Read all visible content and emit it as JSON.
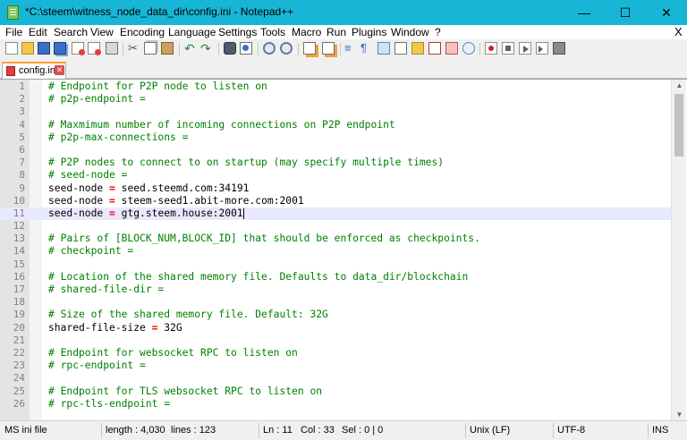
{
  "window": {
    "title": "*C:\\steem\\witness_node_data_dir\\config.ini - Notepad++",
    "minimize": "—",
    "maximize": "☐",
    "close": "✕"
  },
  "menu": {
    "items": [
      "File",
      "Edit",
      "Search",
      "View",
      "Encoding",
      "Language",
      "Settings",
      "Tools",
      "Macro",
      "Run",
      "Plugins",
      "Window",
      "?"
    ],
    "close_doc": "X"
  },
  "toolbar": {
    "icons": [
      "new-file-icon",
      "open-file-icon",
      "save-icon",
      "save-all-icon",
      "close-icon",
      "close-all-icon",
      "print-icon",
      "cut-icon",
      "copy-icon",
      "paste-icon",
      "undo-icon",
      "redo-icon",
      "find-icon",
      "replace-icon",
      "zoom-in-icon",
      "zoom-out-icon",
      "sync-vertical-icon",
      "sync-horizontal-icon",
      "word-wrap-icon",
      "show-all-chars-icon",
      "indent-guide-icon",
      "doc-map-icon",
      "function-list-icon",
      "folder-workspace-icon",
      "doc-switcher-icon",
      "monitoring-icon",
      "record-macro-icon",
      "stop-macro-icon",
      "play-macro-icon",
      "run-macro-multiple-icon",
      "save-macro-icon"
    ]
  },
  "tab": {
    "label": "config.ini",
    "close": "✕"
  },
  "editor": {
    "current_line": 11,
    "lines": [
      {
        "n": "1",
        "type": "comment",
        "text": "# Endpoint for P2P node to listen on"
      },
      {
        "n": "2",
        "type": "comment",
        "text": "# p2p-endpoint ="
      },
      {
        "n": "3",
        "type": "blank",
        "text": ""
      },
      {
        "n": "4",
        "type": "comment",
        "text": "# Maxmimum number of incoming connections on P2P endpoint"
      },
      {
        "n": "5",
        "type": "comment",
        "text": "# p2p-max-connections ="
      },
      {
        "n": "6",
        "type": "blank",
        "text": ""
      },
      {
        "n": "7",
        "type": "comment",
        "text": "# P2P nodes to connect to on startup (may specify multiple times)"
      },
      {
        "n": "8",
        "type": "comment",
        "text": "# seed-node ="
      },
      {
        "n": "9",
        "type": "kv",
        "key": "seed-node",
        "eq": "=",
        "value": "seed.steemd.com:34191"
      },
      {
        "n": "10",
        "type": "kv",
        "key": "seed-node",
        "eq": "=",
        "value": "steem-seed1.abit-more.com:2001"
      },
      {
        "n": "11",
        "type": "kv",
        "key": "seed-node",
        "eq": "=",
        "value": "gtg.steem.house:2001"
      },
      {
        "n": "12",
        "type": "blank",
        "text": ""
      },
      {
        "n": "13",
        "type": "comment",
        "text": "# Pairs of [BLOCK_NUM,BLOCK_ID] that should be enforced as checkpoints."
      },
      {
        "n": "14",
        "type": "comment",
        "text": "# checkpoint ="
      },
      {
        "n": "15",
        "type": "blank",
        "text": ""
      },
      {
        "n": "16",
        "type": "comment",
        "text": "# Location of the shared memory file. Defaults to data_dir/blockchain"
      },
      {
        "n": "17",
        "type": "comment",
        "text": "# shared-file-dir ="
      },
      {
        "n": "18",
        "type": "blank",
        "text": ""
      },
      {
        "n": "19",
        "type": "comment",
        "text": "# Size of the shared memory file. Default: 32G"
      },
      {
        "n": "20",
        "type": "kv",
        "key": "shared-file-size",
        "eq": "=",
        "value": "32G"
      },
      {
        "n": "21",
        "type": "blank",
        "text": ""
      },
      {
        "n": "22",
        "type": "comment",
        "text": "# Endpoint for websocket RPC to listen on"
      },
      {
        "n": "23",
        "type": "comment",
        "text": "# rpc-endpoint ="
      },
      {
        "n": "24",
        "type": "blank",
        "text": ""
      },
      {
        "n": "25",
        "type": "comment",
        "text": "# Endpoint for TLS websocket RPC to listen on"
      },
      {
        "n": "26",
        "type": "comment",
        "text": "# rpc-tls-endpoint ="
      }
    ]
  },
  "scrollbar": {
    "up": "▲",
    "down": "▼"
  },
  "status": {
    "language": "MS ini file",
    "length": "length : 4,030",
    "lines": "lines : 123",
    "ln": "Ln : 11",
    "col": "Col : 33",
    "sel": "Sel : 0 | 0",
    "eol": "Unix (LF)",
    "encoding": "UTF-8",
    "mode": "INS"
  },
  "colors": {
    "titlebar": "#17b6d6",
    "comment": "#008000",
    "operator": "#ff0000",
    "current_line": "#e8e8ff"
  }
}
